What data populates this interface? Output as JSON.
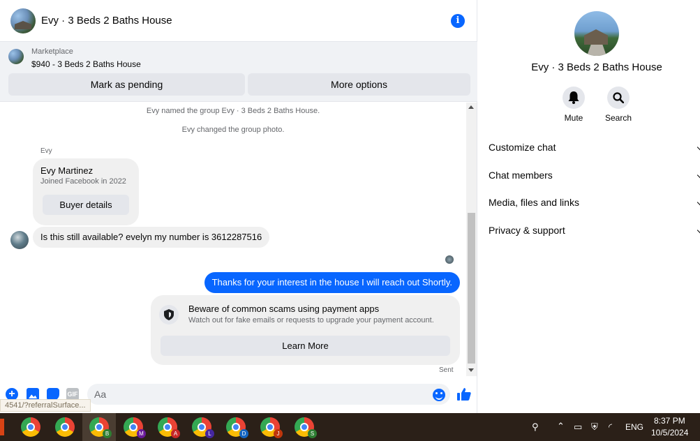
{
  "header": {
    "title": "Evy · 3 Beds 2 Baths House"
  },
  "listing": {
    "kicker": "Marketplace",
    "title": "$940 - 3 Beds 2 Baths House",
    "pending_label": "Mark as pending",
    "more_label": "More options"
  },
  "messages": {
    "system": [
      "Evy named the group Evy · 3 Beds 2 Baths House.",
      "Evy changed the group photo."
    ],
    "sender": "Evy",
    "profile_card": {
      "name": "Evy Martinez",
      "sub": "Joined Facebook in 2022",
      "button": "Buyer details"
    },
    "incoming": "Is this still available? evelyn my number is 3612287516",
    "outgoing": "Thanks for your interest in the house I will reach out Shortly.",
    "scam_card": {
      "title": "Beware of common scams using payment apps",
      "sub": "Watch out for fake emails or requests to upgrade your payment account.",
      "button": "Learn More"
    },
    "status": "Sent"
  },
  "composer": {
    "placeholder": "Aa",
    "gif_label": "GIF"
  },
  "url_hint": "4541/?referralSurface...",
  "info": {
    "name": "Evy · 3 Beds 2 Baths House",
    "actions": [
      {
        "label": "Mute"
      },
      {
        "label": "Search"
      }
    ],
    "rows": [
      "Customize chat",
      "Chat members",
      "Media, files and links",
      "Privacy & support"
    ]
  },
  "taskbar": {
    "badges": [
      "B",
      "M",
      "A",
      "L",
      "D",
      "J",
      "S"
    ],
    "badge_colors": [
      "#2e7d32",
      "#6a1b9a",
      "#c62828",
      "#4527a0",
      "#1565c0",
      "#bf360c",
      "#2e7d32"
    ],
    "lang": "ENG",
    "time": "8:37 PM",
    "date": "10/5/2024"
  },
  "colors": {
    "accent": "#0866ff",
    "bubble_gray": "#f0f0f0"
  }
}
